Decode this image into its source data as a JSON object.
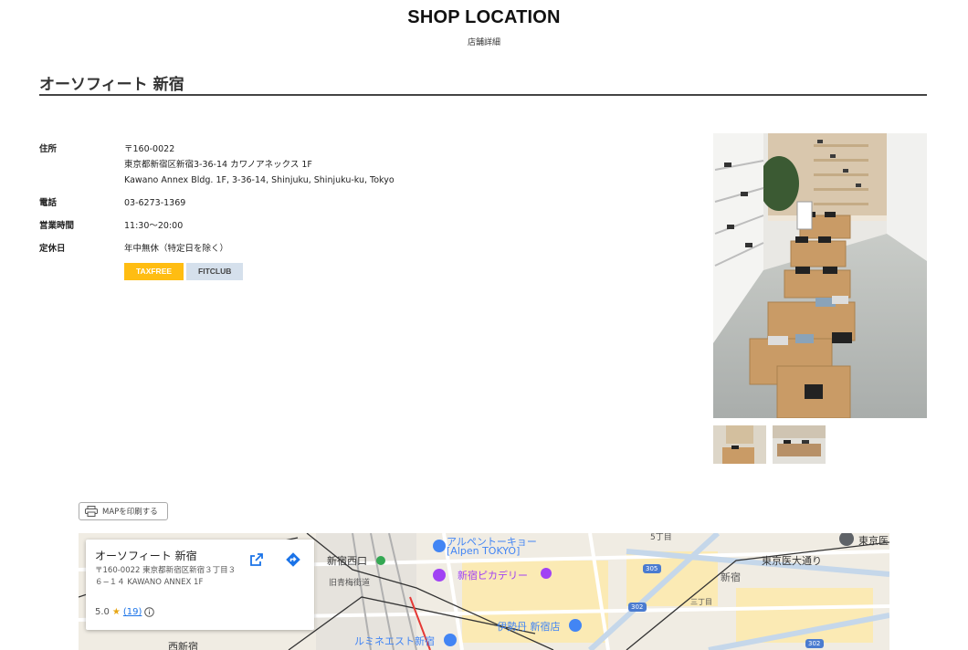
{
  "header": {
    "title": "SHOP LOCATION",
    "subtitle": "店舗詳細"
  },
  "shop": {
    "name": "オーソフィート 新宿"
  },
  "info": {
    "address_label": "住所",
    "postal": "〒160-0022",
    "address_jp": "東京都新宿区新宿3-36-14 カワノアネックス 1F",
    "address_en": "Kawano Annex Bldg. 1F, 3-36-14, Shinjuku, Shinjuku-ku, Tokyo",
    "phone_label": "電話",
    "phone": "03-6273-1369",
    "hours_label": "営業時間",
    "hours": "11:30～20:00",
    "closed_label": "定休日",
    "closed": "年中無休（特定日を除く）"
  },
  "badges": {
    "taxfree": "TAXFREE",
    "fitclub": "FITCLUB"
  },
  "print": {
    "label": "MAPを印刷する"
  },
  "map": {
    "card": {
      "name": "オーソフィート 新宿",
      "address": "〒160-0022 東京都新宿区新宿３丁目３６−１４ KAWANO ANNEX 1F",
      "rating": "5.0",
      "reviews": "(19)"
    },
    "labels": {
      "alpen": "アルペントーキョー",
      "alpen_en": "[Alpen TOKYO]",
      "piccadilly": "新宿ピカデリー",
      "isetan": "伊勢丹 新宿店",
      "lumine": "ルミネエスト新宿",
      "nishiguchi": "新宿西口",
      "kyuome": "旧青梅街道",
      "shinjuku": "新宿",
      "tokyo_ika": "東京医",
      "tokyo_ika_dori": "東京医大通り",
      "gochome": "5丁目",
      "sanchome": "三丁目",
      "nishishinjuku": "西新宿",
      "route305": "305",
      "route302a": "302",
      "route302b": "302"
    }
  },
  "colors": {
    "taxfree": "#ffbd12",
    "fitclub": "#d5e0ec",
    "map_poi": "#4285f4",
    "map_purple": "#a142f4"
  }
}
